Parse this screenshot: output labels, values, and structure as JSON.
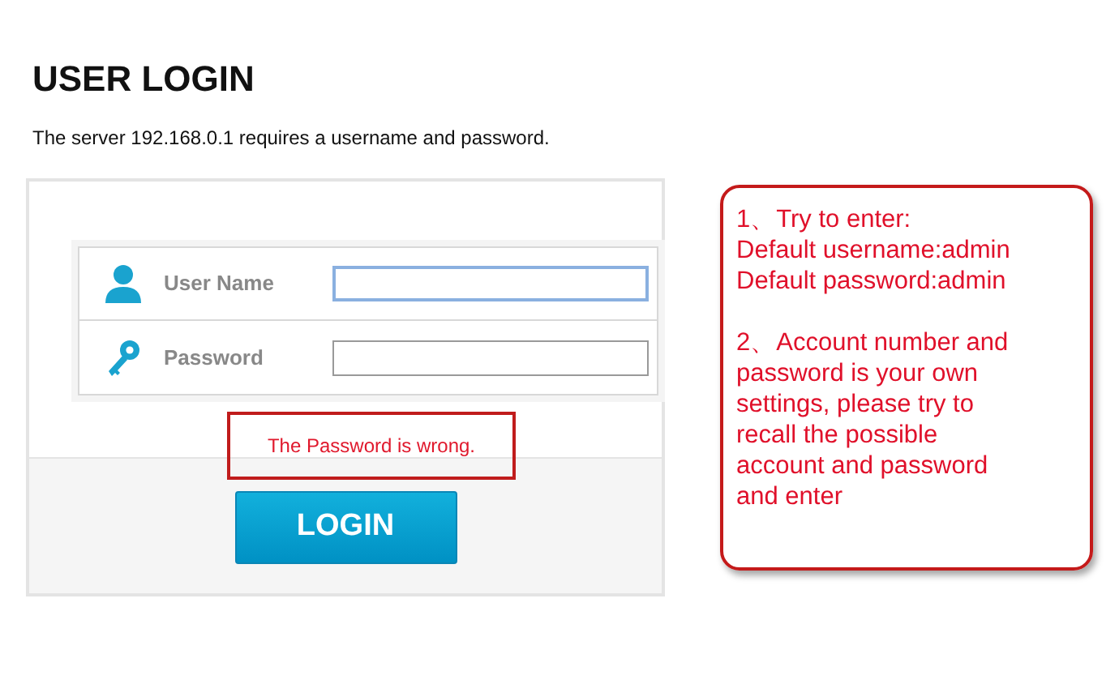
{
  "title": "USER LOGIN",
  "subtitle": "The server  192.168.0.1  requires a username and password.",
  "fields": [
    {
      "kind": "user",
      "label": "User Name",
      "focused": true
    },
    {
      "kind": "key",
      "label": "Password",
      "focused": false
    }
  ],
  "error": "The Password is wrong.",
  "login_button": "LOGIN",
  "note": {
    "paragraphs": [
      {
        "lines": [
          "1、Try to enter:",
          "Default username:admin",
          "Default password:admin"
        ]
      },
      {
        "lines": [
          "2、Account number and",
          "password is your own",
          "settings, please try to",
          "recall the possible",
          "account and password",
          "and enter"
        ]
      }
    ]
  }
}
